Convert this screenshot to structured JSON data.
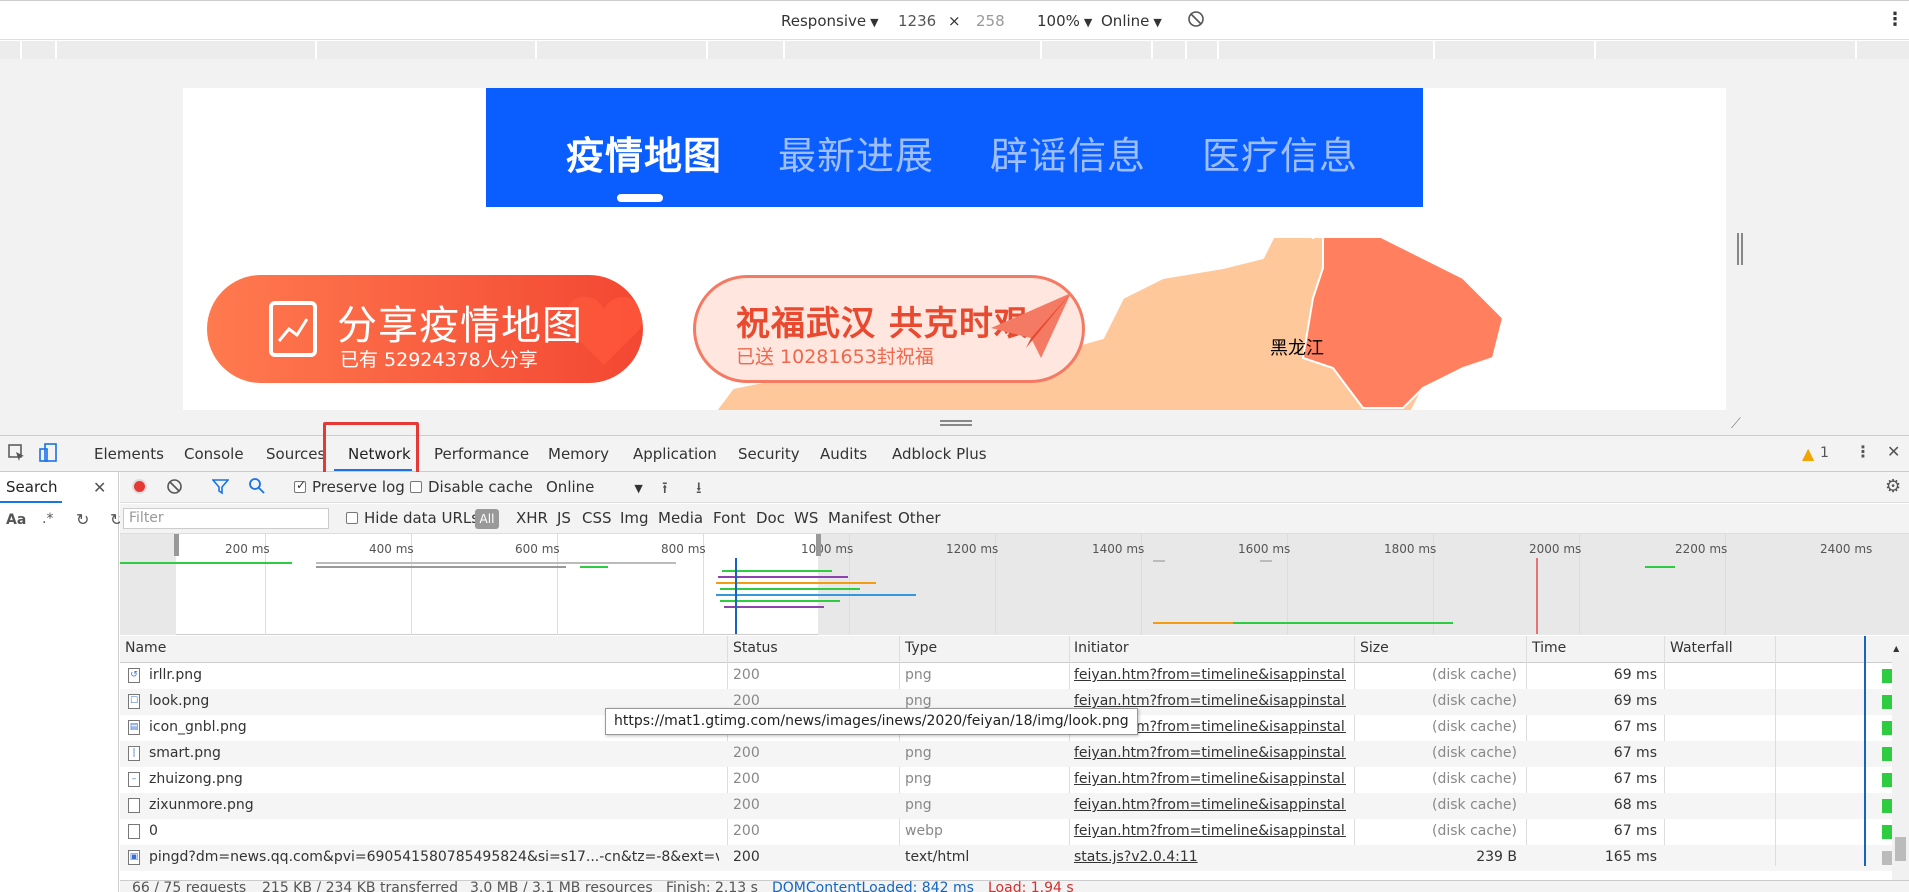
{
  "device_toolbar": {
    "device": "Responsive",
    "width": "1236",
    "times": "×",
    "height": "258",
    "zoom": "100%",
    "throttle": "Online",
    "more": "⋮"
  },
  "page": {
    "nav_tabs": [
      "疫情地图",
      "最新进展",
      "辟谣信息",
      "医疗信息"
    ],
    "share_title": "分享疫情地图",
    "share_sub": "已有 52924378人分享",
    "bless_title": "祝福武汉 共克时艰",
    "bless_sub": "已送 10281653封祝福",
    "map_label": "黑龙江"
  },
  "devtools": {
    "tabs": [
      "Elements",
      "Console",
      "Sources",
      "Network",
      "Performance",
      "Memory",
      "Application",
      "Security",
      "Audits",
      "Adblock Plus"
    ],
    "active_tab": "Network",
    "warning_count": "1",
    "search_label": "Search",
    "search_aa": "Aa",
    "search_regex": ".*",
    "preserve_log": "Preserve log",
    "disable_cache": "Disable cache",
    "throttle": "Online",
    "filter_placeholder": "Filter",
    "hide_data_urls": "Hide data URLs",
    "filter_types": [
      "All",
      "XHR",
      "JS",
      "CSS",
      "Img",
      "Media",
      "Font",
      "Doc",
      "WS",
      "Manifest",
      "Other"
    ],
    "overview_labels": [
      "200 ms",
      "400 ms",
      "600 ms",
      "800 ms",
      "1000 ms",
      "1200 ms",
      "1400 ms",
      "1600 ms",
      "1800 ms",
      "2000 ms",
      "2200 ms",
      "2400 ms"
    ],
    "columns": [
      "Name",
      "Status",
      "Type",
      "Initiator",
      "Size",
      "Time",
      "Waterfall"
    ],
    "rows": [
      {
        "name": "irllr.png",
        "status": "200",
        "type": "png",
        "initiator": "feiyan.htm?from=timeline&isappinstall...",
        "size": "(disk cache)",
        "time": "69 ms"
      },
      {
        "name": "look.png",
        "status": "200",
        "type": "png",
        "initiator": "feiyan.htm?from=timeline&isappinstall...",
        "size": "(disk cache)",
        "time": "69 ms"
      },
      {
        "name": "icon_gnbl.png",
        "status": "200",
        "type": "png",
        "initiator": "feiyan.htm?from=timeline&isappinstall...",
        "size": "(disk cache)",
        "time": "67 ms"
      },
      {
        "name": "smart.png",
        "status": "200",
        "type": "png",
        "initiator": "feiyan.htm?from=timeline&isappinstall...",
        "size": "(disk cache)",
        "time": "67 ms"
      },
      {
        "name": "zhuizong.png",
        "status": "200",
        "type": "png",
        "initiator": "feiyan.htm?from=timeline&isappinstall...",
        "size": "(disk cache)",
        "time": "67 ms"
      },
      {
        "name": "zixunmore.png",
        "status": "200",
        "type": "png",
        "initiator": "feiyan.htm?from=timeline&isappinstall...",
        "size": "(disk cache)",
        "time": "68 ms"
      },
      {
        "name": "0",
        "status": "200",
        "type": "webp",
        "initiator": "feiyan.htm?from=timeline&isappinstall...",
        "size": "(disk cache)",
        "time": "67 ms"
      },
      {
        "name": "pingd?dm=news.qq.com&pvi=690541580785495824&si=s17...-cn&tz=-8&ext=versi...",
        "status": "200",
        "type": "text/html",
        "initiator": "stats.js?v2.0.4:11",
        "size": "239 B",
        "time": "165 ms"
      }
    ],
    "tooltip": "https://mat1.gtimg.com/news/images/inews/2020/feiyan/18/img/look.png",
    "status_bar": {
      "requests": "66 / 75 requests",
      "transferred": "215 KB / 234 KB transferred",
      "resources": "3.0 MB / 3.1 MB resources",
      "finish": "Finish: 2.13 s",
      "dom_loaded": "DOMContentLoaded: 842 ms",
      "load": "Load: 1.94 s"
    },
    "colors": {
      "accent": "#1a73e8",
      "record": "#e53935",
      "load": "#d32f2f",
      "dom": "#1565c0",
      "waterfall": "#2ecc40"
    }
  }
}
